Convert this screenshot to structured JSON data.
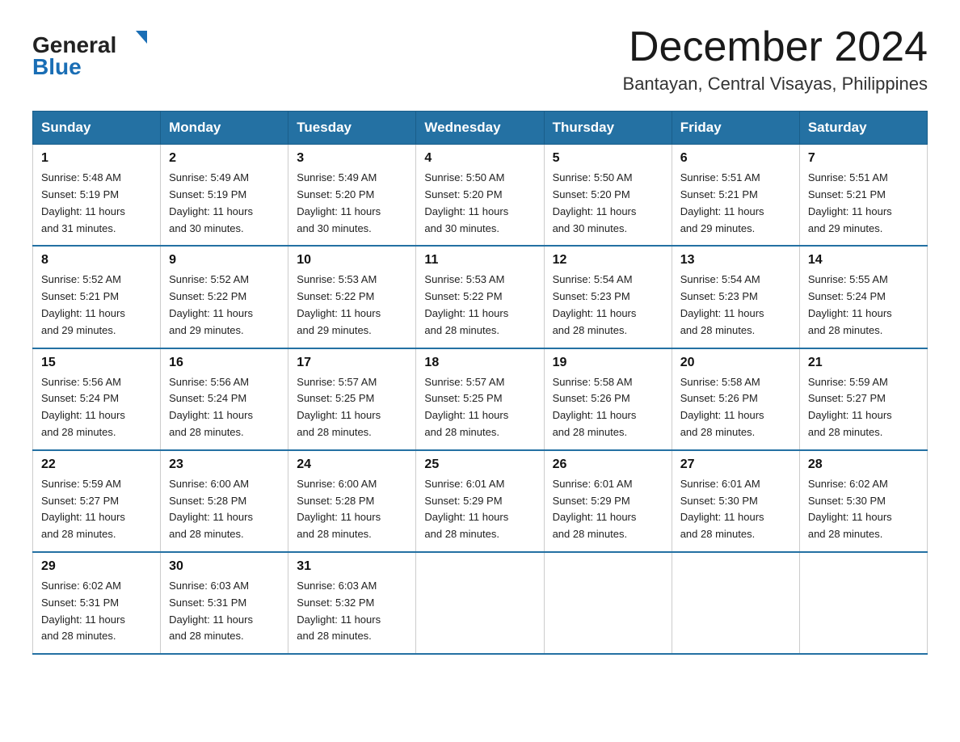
{
  "header": {
    "logo_general": "General",
    "logo_blue": "Blue",
    "month": "December 2024",
    "location": "Bantayan, Central Visayas, Philippines"
  },
  "days_of_week": [
    "Sunday",
    "Monday",
    "Tuesday",
    "Wednesday",
    "Thursday",
    "Friday",
    "Saturday"
  ],
  "weeks": [
    [
      {
        "day": "1",
        "sunrise": "5:48 AM",
        "sunset": "5:19 PM",
        "daylight": "11 hours and 31 minutes."
      },
      {
        "day": "2",
        "sunrise": "5:49 AM",
        "sunset": "5:19 PM",
        "daylight": "11 hours and 30 minutes."
      },
      {
        "day": "3",
        "sunrise": "5:49 AM",
        "sunset": "5:20 PM",
        "daylight": "11 hours and 30 minutes."
      },
      {
        "day": "4",
        "sunrise": "5:50 AM",
        "sunset": "5:20 PM",
        "daylight": "11 hours and 30 minutes."
      },
      {
        "day": "5",
        "sunrise": "5:50 AM",
        "sunset": "5:20 PM",
        "daylight": "11 hours and 30 minutes."
      },
      {
        "day": "6",
        "sunrise": "5:51 AM",
        "sunset": "5:21 PM",
        "daylight": "11 hours and 29 minutes."
      },
      {
        "day": "7",
        "sunrise": "5:51 AM",
        "sunset": "5:21 PM",
        "daylight": "11 hours and 29 minutes."
      }
    ],
    [
      {
        "day": "8",
        "sunrise": "5:52 AM",
        "sunset": "5:21 PM",
        "daylight": "11 hours and 29 minutes."
      },
      {
        "day": "9",
        "sunrise": "5:52 AM",
        "sunset": "5:22 PM",
        "daylight": "11 hours and 29 minutes."
      },
      {
        "day": "10",
        "sunrise": "5:53 AM",
        "sunset": "5:22 PM",
        "daylight": "11 hours and 29 minutes."
      },
      {
        "day": "11",
        "sunrise": "5:53 AM",
        "sunset": "5:22 PM",
        "daylight": "11 hours and 28 minutes."
      },
      {
        "day": "12",
        "sunrise": "5:54 AM",
        "sunset": "5:23 PM",
        "daylight": "11 hours and 28 minutes."
      },
      {
        "day": "13",
        "sunrise": "5:54 AM",
        "sunset": "5:23 PM",
        "daylight": "11 hours and 28 minutes."
      },
      {
        "day": "14",
        "sunrise": "5:55 AM",
        "sunset": "5:24 PM",
        "daylight": "11 hours and 28 minutes."
      }
    ],
    [
      {
        "day": "15",
        "sunrise": "5:56 AM",
        "sunset": "5:24 PM",
        "daylight": "11 hours and 28 minutes."
      },
      {
        "day": "16",
        "sunrise": "5:56 AM",
        "sunset": "5:24 PM",
        "daylight": "11 hours and 28 minutes."
      },
      {
        "day": "17",
        "sunrise": "5:57 AM",
        "sunset": "5:25 PM",
        "daylight": "11 hours and 28 minutes."
      },
      {
        "day": "18",
        "sunrise": "5:57 AM",
        "sunset": "5:25 PM",
        "daylight": "11 hours and 28 minutes."
      },
      {
        "day": "19",
        "sunrise": "5:58 AM",
        "sunset": "5:26 PM",
        "daylight": "11 hours and 28 minutes."
      },
      {
        "day": "20",
        "sunrise": "5:58 AM",
        "sunset": "5:26 PM",
        "daylight": "11 hours and 28 minutes."
      },
      {
        "day": "21",
        "sunrise": "5:59 AM",
        "sunset": "5:27 PM",
        "daylight": "11 hours and 28 minutes."
      }
    ],
    [
      {
        "day": "22",
        "sunrise": "5:59 AM",
        "sunset": "5:27 PM",
        "daylight": "11 hours and 28 minutes."
      },
      {
        "day": "23",
        "sunrise": "6:00 AM",
        "sunset": "5:28 PM",
        "daylight": "11 hours and 28 minutes."
      },
      {
        "day": "24",
        "sunrise": "6:00 AM",
        "sunset": "5:28 PM",
        "daylight": "11 hours and 28 minutes."
      },
      {
        "day": "25",
        "sunrise": "6:01 AM",
        "sunset": "5:29 PM",
        "daylight": "11 hours and 28 minutes."
      },
      {
        "day": "26",
        "sunrise": "6:01 AM",
        "sunset": "5:29 PM",
        "daylight": "11 hours and 28 minutes."
      },
      {
        "day": "27",
        "sunrise": "6:01 AM",
        "sunset": "5:30 PM",
        "daylight": "11 hours and 28 minutes."
      },
      {
        "day": "28",
        "sunrise": "6:02 AM",
        "sunset": "5:30 PM",
        "daylight": "11 hours and 28 minutes."
      }
    ],
    [
      {
        "day": "29",
        "sunrise": "6:02 AM",
        "sunset": "5:31 PM",
        "daylight": "11 hours and 28 minutes."
      },
      {
        "day": "30",
        "sunrise": "6:03 AM",
        "sunset": "5:31 PM",
        "daylight": "11 hours and 28 minutes."
      },
      {
        "day": "31",
        "sunrise": "6:03 AM",
        "sunset": "5:32 PM",
        "daylight": "11 hours and 28 minutes."
      },
      null,
      null,
      null,
      null
    ]
  ],
  "labels": {
    "sunrise": "Sunrise:",
    "sunset": "Sunset:",
    "daylight": "Daylight:"
  }
}
